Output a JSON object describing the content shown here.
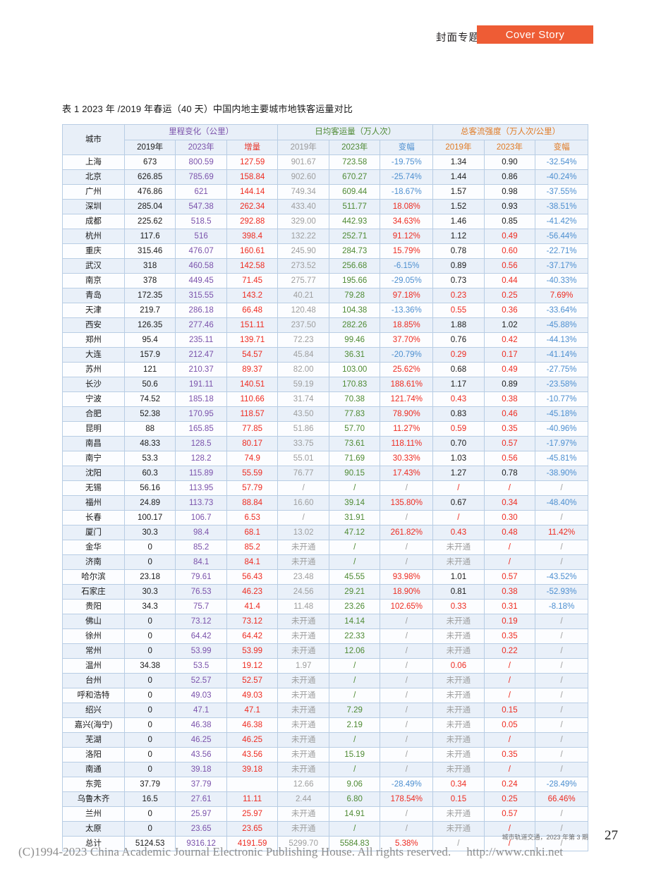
{
  "header": {
    "section_cn": "封面专题",
    "badge_label": "Cover Story",
    "badge_color": "#ee5c35"
  },
  "caption": "表 1  2023 年 /2019 年春运（40 天）中国内地主要城市地铁客运量对比",
  "table": {
    "group_headers": {
      "city": "城市",
      "mileage": "里程变化（公里）",
      "volume": "日均客运量（万人次）",
      "intensity": "总客流强度（万人次/公里）"
    },
    "sub_headers": {
      "m2019": "2019年",
      "m2023": "2023年",
      "minc": "增量",
      "v2019": "2019年",
      "v2023": "2023年",
      "vchg": "变幅",
      "i2019": "2019年",
      "i2023": "2023年",
      "ichg": "变幅"
    },
    "rows": [
      {
        "city": "上海",
        "m2019": "673",
        "m2023": "800.59",
        "minc": "127.59",
        "v2019": "901.67",
        "v2023": "723.58",
        "vchg": "-19.75%",
        "i2019": "1.34",
        "i2023": "0.90",
        "ichg": "-32.54%",
        "i2019c": "b",
        "i2023c": "b",
        "ichgc": "blue",
        "vchgc": "blue"
      },
      {
        "city": "北京",
        "m2019": "626.85",
        "m2023": "785.69",
        "minc": "158.84",
        "v2019": "902.60",
        "v2023": "670.27",
        "vchg": "-25.74%",
        "i2019": "1.44",
        "i2023": "0.86",
        "ichg": "-40.24%",
        "i2019c": "b",
        "i2023c": "b",
        "ichgc": "blue",
        "vchgc": "blue"
      },
      {
        "city": "广州",
        "m2019": "476.86",
        "m2023": "621",
        "minc": "144.14",
        "v2019": "749.34",
        "v2023": "609.44",
        "vchg": "-18.67%",
        "i2019": "1.57",
        "i2023": "0.98",
        "ichg": "-37.55%",
        "i2019c": "b",
        "i2023c": "b",
        "ichgc": "blue",
        "vchgc": "blue"
      },
      {
        "city": "深圳",
        "m2019": "285.04",
        "m2023": "547.38",
        "minc": "262.34",
        "v2019": "433.40",
        "v2023": "511.77",
        "vchg": "18.08%",
        "i2019": "1.52",
        "i2023": "0.93",
        "ichg": "-38.51%",
        "i2019c": "b",
        "i2023c": "b",
        "ichgc": "blue",
        "vchgc": "red"
      },
      {
        "city": "成都",
        "m2019": "225.62",
        "m2023": "518.5",
        "minc": "292.88",
        "v2019": "329.00",
        "v2023": "442.93",
        "vchg": "34.63%",
        "i2019": "1.46",
        "i2023": "0.85",
        "ichg": "-41.42%",
        "i2019c": "b",
        "i2023c": "b",
        "ichgc": "blue",
        "vchgc": "red"
      },
      {
        "city": "杭州",
        "m2019": "117.6",
        "m2023": "516",
        "minc": "398.4",
        "v2019": "132.22",
        "v2023": "252.71",
        "vchg": "91.12%",
        "i2019": "1.12",
        "i2023": "0.49",
        "ichg": "-56.44%",
        "i2019c": "b",
        "i2023c": "red",
        "ichgc": "blue",
        "vchgc": "red"
      },
      {
        "city": "重庆",
        "m2019": "315.46",
        "m2023": "476.07",
        "minc": "160.61",
        "v2019": "245.90",
        "v2023": "284.73",
        "vchg": "15.79%",
        "i2019": "0.78",
        "i2023": "0.60",
        "ichg": "-22.71%",
        "i2019c": "b",
        "i2023c": "red",
        "ichgc": "blue",
        "vchgc": "red"
      },
      {
        "city": "武汉",
        "m2019": "318",
        "m2023": "460.58",
        "minc": "142.58",
        "v2019": "273.52",
        "v2023": "256.68",
        "vchg": "-6.15%",
        "i2019": "0.89",
        "i2023": "0.56",
        "ichg": "-37.17%",
        "i2019c": "b",
        "i2023c": "red",
        "ichgc": "blue",
        "vchgc": "blue"
      },
      {
        "city": "南京",
        "m2019": "378",
        "m2023": "449.45",
        "minc": "71.45",
        "v2019": "275.77",
        "v2023": "195.66",
        "vchg": "-29.05%",
        "i2019": "0.73",
        "i2023": "0.44",
        "ichg": "-40.33%",
        "i2019c": "b",
        "i2023c": "red",
        "ichgc": "blue",
        "vchgc": "blue"
      },
      {
        "city": "青岛",
        "m2019": "172.35",
        "m2023": "315.55",
        "minc": "143.2",
        "v2019": "40.21",
        "v2023": "79.28",
        "vchg": "97.18%",
        "i2019": "0.23",
        "i2023": "0.25",
        "ichg": "7.69%",
        "i2019c": "red",
        "i2023c": "red",
        "ichgc": "red",
        "vchgc": "red"
      },
      {
        "city": "天津",
        "m2019": "219.7",
        "m2023": "286.18",
        "minc": "66.48",
        "v2019": "120.48",
        "v2023": "104.38",
        "vchg": "-13.36%",
        "i2019": "0.55",
        "i2023": "0.36",
        "ichg": "-33.64%",
        "i2019c": "red",
        "i2023c": "red",
        "ichgc": "blue",
        "vchgc": "blue"
      },
      {
        "city": "西安",
        "m2019": "126.35",
        "m2023": "277.46",
        "minc": "151.11",
        "v2019": "237.50",
        "v2023": "282.26",
        "vchg": "18.85%",
        "i2019": "1.88",
        "i2023": "1.02",
        "ichg": "-45.88%",
        "i2019c": "b",
        "i2023c": "b",
        "ichgc": "blue",
        "vchgc": "red"
      },
      {
        "city": "郑州",
        "m2019": "95.4",
        "m2023": "235.11",
        "minc": "139.71",
        "v2019": "72.23",
        "v2023": "99.46",
        "vchg": "37.70%",
        "i2019": "0.76",
        "i2023": "0.42",
        "ichg": "-44.13%",
        "i2019c": "b",
        "i2023c": "red",
        "ichgc": "blue",
        "vchgc": "red"
      },
      {
        "city": "大连",
        "m2019": "157.9",
        "m2023": "212.47",
        "minc": "54.57",
        "v2019": "45.84",
        "v2023": "36.31",
        "vchg": "-20.79%",
        "i2019": "0.29",
        "i2023": "0.17",
        "ichg": "-41.14%",
        "i2019c": "red",
        "i2023c": "red",
        "ichgc": "blue",
        "vchgc": "blue"
      },
      {
        "city": "苏州",
        "m2019": "121",
        "m2023": "210.37",
        "minc": "89.37",
        "v2019": "82.00",
        "v2023": "103.00",
        "vchg": "25.62%",
        "i2019": "0.68",
        "i2023": "0.49",
        "ichg": "-27.75%",
        "i2019c": "b",
        "i2023c": "red",
        "ichgc": "blue",
        "vchgc": "red"
      },
      {
        "city": "长沙",
        "m2019": "50.6",
        "m2023": "191.11",
        "minc": "140.51",
        "v2019": "59.19",
        "v2023": "170.83",
        "vchg": "188.61%",
        "i2019": "1.17",
        "i2023": "0.89",
        "ichg": "-23.58%",
        "i2019c": "b",
        "i2023c": "b",
        "ichgc": "blue",
        "vchgc": "red"
      },
      {
        "city": "宁波",
        "m2019": "74.52",
        "m2023": "185.18",
        "minc": "110.66",
        "v2019": "31.74",
        "v2023": "70.38",
        "vchg": "121.74%",
        "i2019": "0.43",
        "i2023": "0.38",
        "ichg": "-10.77%",
        "i2019c": "red",
        "i2023c": "red",
        "ichgc": "blue",
        "vchgc": "red"
      },
      {
        "city": "合肥",
        "m2019": "52.38",
        "m2023": "170.95",
        "minc": "118.57",
        "v2019": "43.50",
        "v2023": "77.83",
        "vchg": "78.90%",
        "i2019": "0.83",
        "i2023": "0.46",
        "ichg": "-45.18%",
        "i2019c": "b",
        "i2023c": "red",
        "ichgc": "blue",
        "vchgc": "red"
      },
      {
        "city": "昆明",
        "m2019": "88",
        "m2023": "165.85",
        "minc": "77.85",
        "v2019": "51.86",
        "v2023": "57.70",
        "vchg": "11.27%",
        "i2019": "0.59",
        "i2023": "0.35",
        "ichg": "-40.96%",
        "i2019c": "red",
        "i2023c": "red",
        "ichgc": "blue",
        "vchgc": "red"
      },
      {
        "city": "南昌",
        "m2019": "48.33",
        "m2023": "128.5",
        "minc": "80.17",
        "v2019": "33.75",
        "v2023": "73.61",
        "vchg": "118.11%",
        "i2019": "0.70",
        "i2023": "0.57",
        "ichg": "-17.97%",
        "i2019c": "b",
        "i2023c": "red",
        "ichgc": "blue",
        "vchgc": "red"
      },
      {
        "city": "南宁",
        "m2019": "53.3",
        "m2023": "128.2",
        "minc": "74.9",
        "v2019": "55.01",
        "v2023": "71.69",
        "vchg": "30.33%",
        "i2019": "1.03",
        "i2023": "0.56",
        "ichg": "-45.81%",
        "i2019c": "b",
        "i2023c": "red",
        "ichgc": "blue",
        "vchgc": "red"
      },
      {
        "city": "沈阳",
        "m2019": "60.3",
        "m2023": "115.89",
        "minc": "55.59",
        "v2019": "76.77",
        "v2023": "90.15",
        "vchg": "17.43%",
        "i2019": "1.27",
        "i2023": "0.78",
        "ichg": "-38.90%",
        "i2019c": "b",
        "i2023c": "b",
        "ichgc": "blue",
        "vchgc": "red"
      },
      {
        "city": "无锡",
        "m2019": "56.16",
        "m2023": "113.95",
        "minc": "57.79",
        "v2019": "/",
        "v2023": "/",
        "vchg": "/",
        "i2019": "/",
        "i2023": "/",
        "ichg": "/",
        "v2019c": "gray",
        "v2023c": "green",
        "vchgc": "gray",
        "i2019c": "red",
        "i2023c": "red",
        "ichgc": "gray"
      },
      {
        "city": "福州",
        "m2019": "24.89",
        "m2023": "113.73",
        "minc": "88.84",
        "v2019": "16.60",
        "v2023": "39.14",
        "vchg": "135.80%",
        "i2019": "0.67",
        "i2023": "0.34",
        "ichg": "-48.40%",
        "i2019c": "b",
        "i2023c": "red",
        "ichgc": "blue",
        "vchgc": "red"
      },
      {
        "city": "长春",
        "m2019": "100.17",
        "m2023": "106.7",
        "minc": "6.53",
        "v2019": "/",
        "v2023": "31.91",
        "vchg": "/",
        "i2019": "/",
        "i2023": "0.30",
        "ichg": "/",
        "v2019c": "gray",
        "vchgc": "gray",
        "i2019c": "red",
        "i2023c": "red",
        "ichgc": "gray"
      },
      {
        "city": "厦门",
        "m2019": "30.3",
        "m2023": "98.4",
        "minc": "68.1",
        "v2019": "13.02",
        "v2023": "47.12",
        "vchg": "261.82%",
        "i2019": "0.43",
        "i2023": "0.48",
        "ichg": "11.42%",
        "i2019c": "red",
        "i2023c": "red",
        "ichgc": "red",
        "vchgc": "red"
      },
      {
        "city": "金华",
        "m2019": "0",
        "m2023": "85.2",
        "minc": "85.2",
        "v2019": "未开通",
        "v2023": "/",
        "vchg": "/",
        "i2019": "未开通",
        "i2023": "/",
        "ichg": "/",
        "v2019c": "gray",
        "v2023c": "green",
        "vchgc": "gray",
        "i2019c": "gray",
        "i2023c": "red",
        "ichgc": "gray"
      },
      {
        "city": "济南",
        "m2019": "0",
        "m2023": "84.1",
        "minc": "84.1",
        "v2019": "未开通",
        "v2023": "/",
        "vchg": "/",
        "i2019": "未开通",
        "i2023": "/",
        "ichg": "/",
        "v2019c": "gray",
        "v2023c": "green",
        "vchgc": "gray",
        "i2019c": "gray",
        "i2023c": "red",
        "ichgc": "gray"
      },
      {
        "city": "哈尔滨",
        "m2019": "23.18",
        "m2023": "79.61",
        "minc": "56.43",
        "v2019": "23.48",
        "v2023": "45.55",
        "vchg": "93.98%",
        "i2019": "1.01",
        "i2023": "0.57",
        "ichg": "-43.52%",
        "i2019c": "b",
        "i2023c": "red",
        "ichgc": "blue",
        "vchgc": "red"
      },
      {
        "city": "石家庄",
        "m2019": "30.3",
        "m2023": "76.53",
        "minc": "46.23",
        "v2019": "24.56",
        "v2023": "29.21",
        "vchg": "18.90%",
        "i2019": "0.81",
        "i2023": "0.38",
        "ichg": "-52.93%",
        "i2019c": "b",
        "i2023c": "red",
        "ichgc": "blue",
        "vchgc": "red"
      },
      {
        "city": "贵阳",
        "m2019": "34.3",
        "m2023": "75.7",
        "minc": "41.4",
        "v2019": "11.48",
        "v2023": "23.26",
        "vchg": "102.65%",
        "i2019": "0.33",
        "i2023": "0.31",
        "ichg": "-8.18%",
        "i2019c": "red",
        "i2023c": "red",
        "ichgc": "blue",
        "vchgc": "red"
      },
      {
        "city": "佛山",
        "m2019": "0",
        "m2023": "73.12",
        "minc": "73.12",
        "v2019": "未开通",
        "v2023": "14.14",
        "vchg": "/",
        "i2019": "未开通",
        "i2023": "0.19",
        "ichg": "/",
        "v2019c": "gray",
        "vchgc": "gray",
        "i2019c": "gray",
        "i2023c": "red",
        "ichgc": "gray"
      },
      {
        "city": "徐州",
        "m2019": "0",
        "m2023": "64.42",
        "minc": "64.42",
        "v2019": "未开通",
        "v2023": "22.33",
        "vchg": "/",
        "i2019": "未开通",
        "i2023": "0.35",
        "ichg": "/",
        "v2019c": "gray",
        "vchgc": "gray",
        "i2019c": "gray",
        "i2023c": "red",
        "ichgc": "gray"
      },
      {
        "city": "常州",
        "m2019": "0",
        "m2023": "53.99",
        "minc": "53.99",
        "v2019": "未开通",
        "v2023": "12.06",
        "vchg": "/",
        "i2019": "未开通",
        "i2023": "0.22",
        "ichg": "/",
        "v2019c": "gray",
        "vchgc": "gray",
        "i2019c": "gray",
        "i2023c": "red",
        "ichgc": "gray"
      },
      {
        "city": "温州",
        "m2019": "34.38",
        "m2023": "53.5",
        "minc": "19.12",
        "v2019": "1.97",
        "v2023": "/",
        "vchg": "/",
        "i2019": "0.06",
        "i2023": "/",
        "ichg": "/",
        "v2019c": "gray",
        "v2023c": "green",
        "vchgc": "gray",
        "i2019c": "red",
        "i2023c": "red",
        "ichgc": "gray"
      },
      {
        "city": "台州",
        "m2019": "0",
        "m2023": "52.57",
        "minc": "52.57",
        "v2019": "未开通",
        "v2023": "/",
        "vchg": "/",
        "i2019": "未开通",
        "i2023": "/",
        "ichg": "/",
        "v2019c": "gray",
        "v2023c": "green",
        "vchgc": "gray",
        "i2019c": "gray",
        "i2023c": "red",
        "ichgc": "gray"
      },
      {
        "city": "呼和浩特",
        "m2019": "0",
        "m2023": "49.03",
        "minc": "49.03",
        "v2019": "未开通",
        "v2023": "/",
        "vchg": "/",
        "i2019": "未开通",
        "i2023": "/",
        "ichg": "/",
        "v2019c": "gray",
        "v2023c": "green",
        "vchgc": "gray",
        "i2019c": "gray",
        "i2023c": "red",
        "ichgc": "gray"
      },
      {
        "city": "绍兴",
        "m2019": "0",
        "m2023": "47.1",
        "minc": "47.1",
        "v2019": "未开通",
        "v2023": "7.29",
        "vchg": "/",
        "i2019": "未开通",
        "i2023": "0.15",
        "ichg": "/",
        "v2019c": "gray",
        "vchgc": "gray",
        "i2019c": "gray",
        "i2023c": "red",
        "ichgc": "gray"
      },
      {
        "city": "嘉兴(海宁)",
        "m2019": "0",
        "m2023": "46.38",
        "minc": "46.38",
        "v2019": "未开通",
        "v2023": "2.19",
        "vchg": "/",
        "i2019": "未开通",
        "i2023": "0.05",
        "ichg": "/",
        "v2019c": "gray",
        "vchgc": "gray",
        "i2019c": "gray",
        "i2023c": "red",
        "ichgc": "gray"
      },
      {
        "city": "芜湖",
        "m2019": "0",
        "m2023": "46.25",
        "minc": "46.25",
        "v2019": "未开通",
        "v2023": "/",
        "vchg": "/",
        "i2019": "未开通",
        "i2023": "/",
        "ichg": "/",
        "v2019c": "gray",
        "v2023c": "green",
        "vchgc": "gray",
        "i2019c": "gray",
        "i2023c": "red",
        "ichgc": "gray"
      },
      {
        "city": "洛阳",
        "m2019": "0",
        "m2023": "43.56",
        "minc": "43.56",
        "v2019": "未开通",
        "v2023": "15.19",
        "vchg": "/",
        "i2019": "未开通",
        "i2023": "0.35",
        "ichg": "/",
        "v2019c": "gray",
        "vchgc": "gray",
        "i2019c": "gray",
        "i2023c": "red",
        "ichgc": "gray"
      },
      {
        "city": "南通",
        "m2019": "0",
        "m2023": "39.18",
        "minc": "39.18",
        "v2019": "未开通",
        "v2023": "/",
        "vchg": "/",
        "i2019": "未开通",
        "i2023": "/",
        "ichg": "/",
        "v2019c": "gray",
        "v2023c": "green",
        "vchgc": "gray",
        "i2019c": "gray",
        "i2023c": "red",
        "ichgc": "gray"
      },
      {
        "city": "东莞",
        "m2019": "37.79",
        "m2023": "37.79",
        "minc": "",
        "v2019": "12.66",
        "v2023": "9.06",
        "vchg": "-28.49%",
        "i2019": "0.34",
        "i2023": "0.24",
        "ichg": "-28.49%",
        "i2019c": "red",
        "i2023c": "red",
        "ichgc": "blue",
        "vchgc": "blue"
      },
      {
        "city": "乌鲁木齐",
        "m2019": "16.5",
        "m2023": "27.61",
        "minc": "11.11",
        "v2019": "2.44",
        "v2023": "6.80",
        "vchg": "178.54%",
        "i2019": "0.15",
        "i2023": "0.25",
        "ichg": "66.46%",
        "i2019c": "red",
        "i2023c": "red",
        "ichgc": "red",
        "vchgc": "red"
      },
      {
        "city": "兰州",
        "m2019": "0",
        "m2023": "25.97",
        "minc": "25.97",
        "v2019": "未开通",
        "v2023": "14.91",
        "vchg": "/",
        "i2019": "未开通",
        "i2023": "0.57",
        "ichg": "/",
        "v2019c": "gray",
        "vchgc": "gray",
        "i2019c": "gray",
        "i2023c": "red",
        "ichgc": "gray"
      },
      {
        "city": "太原",
        "m2019": "0",
        "m2023": "23.65",
        "minc": "23.65",
        "v2019": "未开通",
        "v2023": "/",
        "vchg": "/",
        "i2019": "未开通",
        "i2023": "/",
        "ichg": "/",
        "v2019c": "gray",
        "v2023c": "green",
        "vchgc": "gray",
        "i2019c": "gray",
        "i2023c": "red",
        "ichgc": "gray"
      },
      {
        "city": "总计",
        "m2019": "5124.53",
        "m2023": "9316.12",
        "minc": "4191.59",
        "v2019": "5299.70",
        "v2023": "5584.83",
        "vchg": "5.38%",
        "i2019": "/",
        "i2023": "/",
        "ichg": "/",
        "vchgc": "red",
        "i2019c": "gray",
        "i2023c": "red",
        "ichgc": "gray",
        "total": true
      }
    ]
  },
  "footer": {
    "journal": "城市轨道交通，2023 年第 3 期",
    "page_number": "27",
    "copyright": "(C)1994-2023 China Academic Journal Electronic Publishing House. All rights reserved.",
    "url": "http://www.cnki.net"
  }
}
